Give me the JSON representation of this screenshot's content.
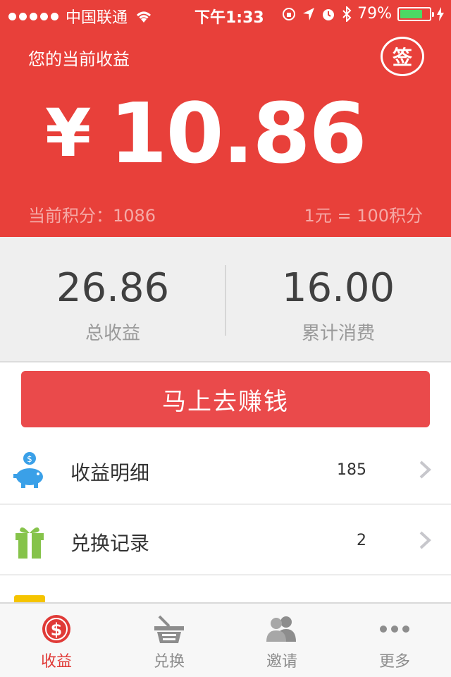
{
  "status_bar": {
    "carrier": "中国联通",
    "time": "下午1:33",
    "battery": "79%"
  },
  "header": {
    "title": "您的当前收益",
    "sign_badge": "签",
    "currency_symbol": "¥",
    "amount": "10.86",
    "points_label": "当前积分：1086",
    "rate_label": "1元 = 100积分"
  },
  "stats": {
    "total_income": {
      "value": "26.86",
      "label": "总收益"
    },
    "total_spent": {
      "value": "16.00",
      "label": "累计消费"
    }
  },
  "earn_button": {
    "label": "马上去赚钱"
  },
  "list": [
    {
      "label": "收益明细",
      "count": "185",
      "icon": "piggy-bank-icon"
    },
    {
      "label": "兑换记录",
      "count": "2",
      "icon": "gift-icon"
    }
  ],
  "tabbar": [
    {
      "label": "收益",
      "icon": "dollar-coin-icon",
      "active": true
    },
    {
      "label": "兑换",
      "icon": "basket-icon",
      "active": false
    },
    {
      "label": "邀请",
      "icon": "users-icon",
      "active": false
    },
    {
      "label": "更多",
      "icon": "more-dots-icon",
      "active": false
    }
  ],
  "colors": {
    "accent": "#e8403a",
    "button": "#ea4a4b",
    "battery": "#4cd964"
  }
}
